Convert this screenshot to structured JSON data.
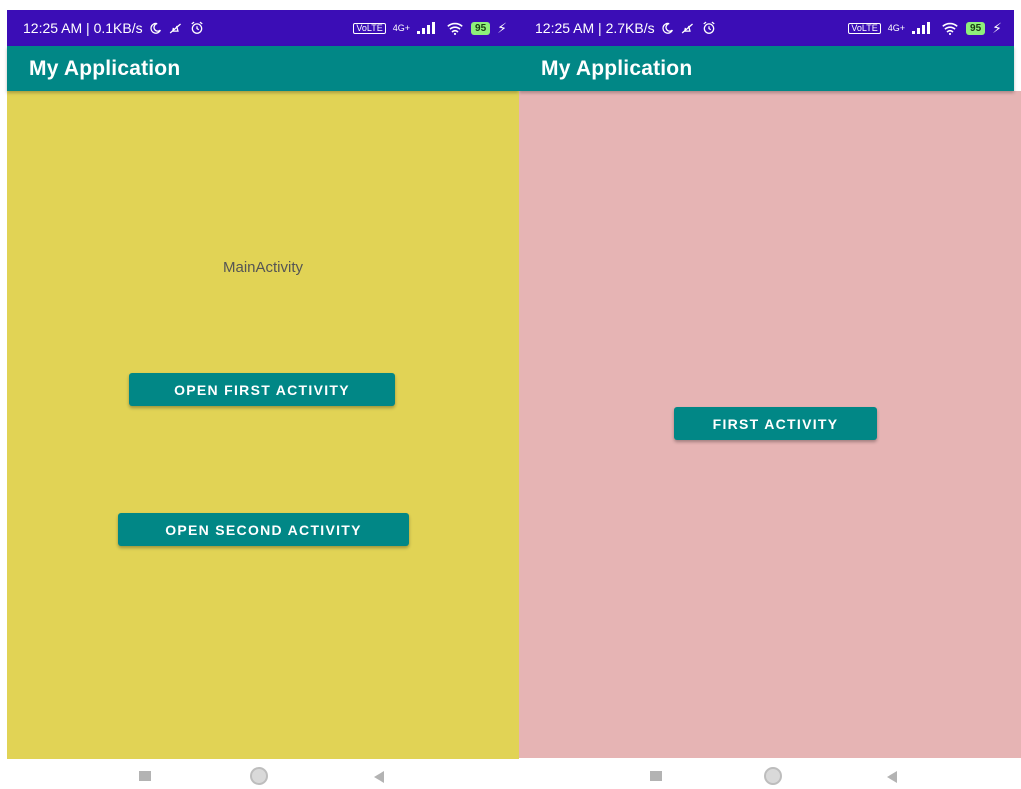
{
  "left_screen": {
    "status": {
      "time_speed": "12:25 AM | 0.1KB/s",
      "battery": "95"
    },
    "app_bar": {
      "title": "My Application"
    },
    "label": "MainActivity",
    "buttons": {
      "open_first": "OPEN FIRST ACTIVITY",
      "open_second": "OPEN SECOND ACTIVITY"
    },
    "background_color": "#e1d355"
  },
  "right_screen": {
    "status": {
      "time_speed": "12:25 AM | 2.7KB/s",
      "battery": "95"
    },
    "app_bar": {
      "title": "My Application"
    },
    "buttons": {
      "first_activity": "FIRST ACTIVITY"
    },
    "background_color": "#e6b4b4"
  },
  "colors": {
    "status_bar": "#3b0db6",
    "app_bar": "#018786",
    "button": "#018786"
  },
  "status_icons": [
    "moon-icon",
    "mute-notifications-icon",
    "alarm-icon",
    "volte-icon",
    "signal-4g-icon",
    "signal-icon",
    "wifi-icon",
    "battery-icon",
    "charging-icon"
  ],
  "nav_icons": [
    "recents-square-icon",
    "home-circle-icon",
    "back-triangle-icon"
  ]
}
